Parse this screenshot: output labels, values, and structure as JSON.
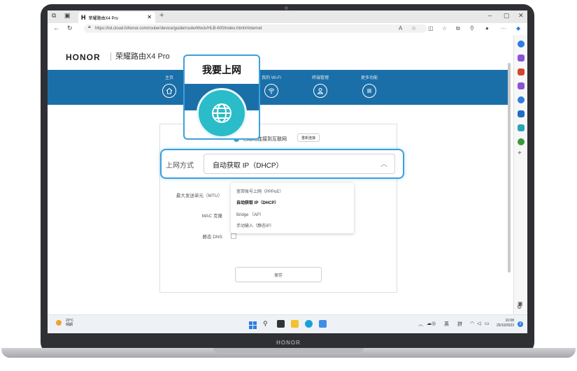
{
  "browser": {
    "tab_title": "荣耀路由X4 Pro",
    "tab_h": "H",
    "new_tab": "+",
    "url": "https://iot.cloud.hihonor.com/router/device/guide/routerMock/HLB-600/index.html#/internet"
  },
  "header": {
    "brand": "HONOR",
    "product": "荣耀路由X4 Pro"
  },
  "nav": {
    "items": [
      {
        "label": "主页",
        "icon": "home-icon"
      },
      {
        "label": "我的 Wi-Fi",
        "icon": "wifi-icon"
      },
      {
        "label": "终端管理",
        "icon": "user-icon"
      },
      {
        "label": "更多功能",
        "icon": "menu-icon"
      }
    ]
  },
  "callout": {
    "title": "我要上网",
    "icon": "globe-icon"
  },
  "internet": {
    "status": "已成功连接到互联网",
    "reconnect_label": "重新连接",
    "mode_label": "上网方式",
    "mode_value": "自动获取 IP（DHCP）",
    "fields": [
      "最大发送单元（MTU）",
      "MAC 克隆",
      "静态 DNS"
    ],
    "options": [
      {
        "label": "宽带账号上网（PPPoE）",
        "selected": false
      },
      {
        "label": "自动获取 IP（DHCP）",
        "selected": true
      },
      {
        "label": "Bridge （AP）",
        "selected": false
      },
      {
        "label": "手动输入（静态IP）",
        "selected": false
      }
    ],
    "save_label": "保存"
  },
  "taskbar": {
    "weather_temp": "20°C",
    "weather_desc": "晴朗",
    "ime_lang": "英",
    "ime_mode": "拼",
    "time": "10:08",
    "date": "25/10/2023",
    "notification_count": "2"
  },
  "device": {
    "bezel_brand": "HONOR"
  },
  "colors": {
    "banner": "#1b6fa8",
    "accent": "#2abcc8",
    "highlight_border": "#3aa0e0"
  }
}
